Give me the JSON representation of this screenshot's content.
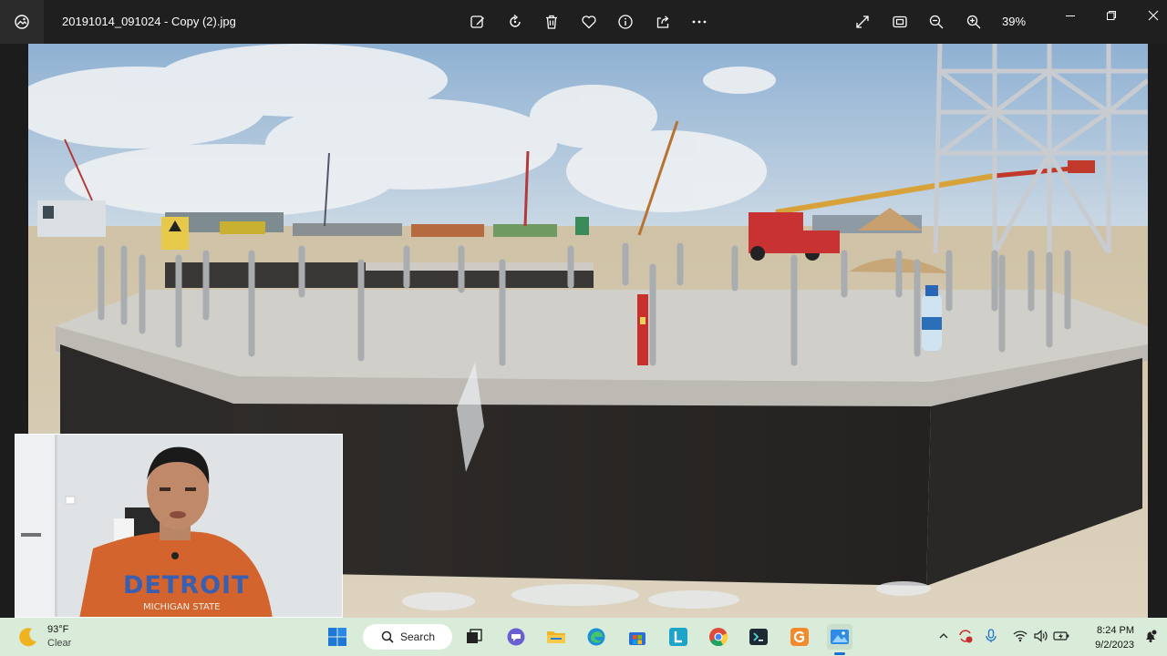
{
  "window": {
    "file_name": "20191014_091024 - Copy (2).jpg",
    "zoom": "39%"
  },
  "toolbar": {
    "left_actions": [
      "edit-image-icon",
      "rotate-icon",
      "delete-icon",
      "favorite-icon",
      "info-icon",
      "share-icon",
      "more-icon"
    ],
    "right_actions": [
      "fullscreen-icon",
      "fit-to-window-icon",
      "zoom-out-icon",
      "zoom-in-icon"
    ]
  },
  "photo": {
    "description_elements": [
      "sky",
      "construction-site",
      "concrete-foundation",
      "anchor-bolts",
      "water-bottle",
      "red-spirit-level",
      "steel-structure",
      "cranes",
      "boom-lift"
    ],
    "colors": {
      "sky": "#a9c2db",
      "concrete_top": "#c9c7c1",
      "concrete_wall": "#2a2827",
      "sand": "#d8cdb6"
    }
  },
  "webcam": {
    "shirt_text_line1": "DETROIT",
    "shirt_text_line2": "MICHIGAN STATE"
  },
  "taskbar": {
    "weather_temp": "93°F",
    "weather_desc": "Clear",
    "search_label": "Search",
    "apps": [
      "start-icon",
      "task-view-icon",
      "teams-chat-icon",
      "file-explorer-icon",
      "edge-icon",
      "microsoft-store-icon",
      "learn-app-icon",
      "chrome-icon",
      "terminal-icon",
      "grammarly-icon",
      "photos-icon"
    ],
    "clock_time": "8:24 PM",
    "clock_date": "9/2/2023",
    "accent": "#1e6fd0"
  }
}
